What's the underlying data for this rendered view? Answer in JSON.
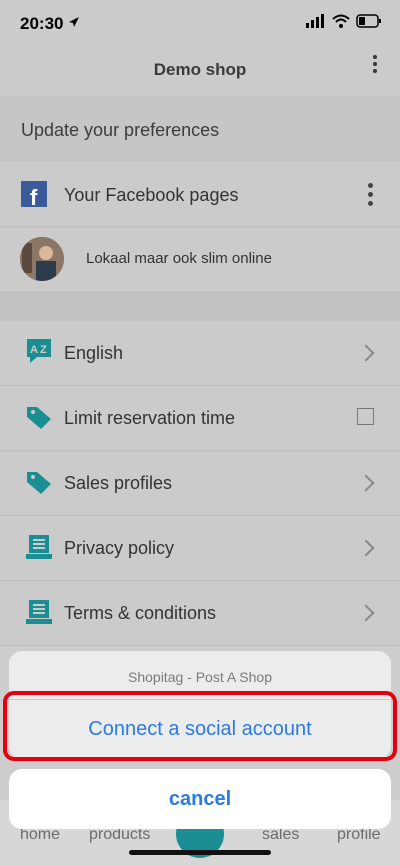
{
  "status": {
    "time": "20:30"
  },
  "nav": {
    "title": "Demo shop"
  },
  "preferences": {
    "header": "Update your preferences"
  },
  "facebook": {
    "label": "Your Facebook pages",
    "page_name": "Lokaal maar ook slim online"
  },
  "settings": {
    "language": "English",
    "limit_reservation": "Limit reservation time",
    "sales_profiles": "Sales profiles",
    "privacy": "Privacy policy",
    "terms": "Terms & conditions"
  },
  "tabs": {
    "home": "home",
    "products": "products",
    "sales": "sales",
    "profile": "profile"
  },
  "action_sheet": {
    "title": "Shopitag - Post A Shop",
    "connect": "Connect a social account",
    "cancel": "cancel"
  },
  "colors": {
    "accent": "#2a7be3",
    "teal": "#1a8e92",
    "highlight": "#e3000f",
    "facebook": "#3a5a9a"
  },
  "icons": {
    "facebook": "facebook-icon",
    "language": "translate-icon",
    "tag": "tag-icon",
    "document": "document-icon"
  }
}
